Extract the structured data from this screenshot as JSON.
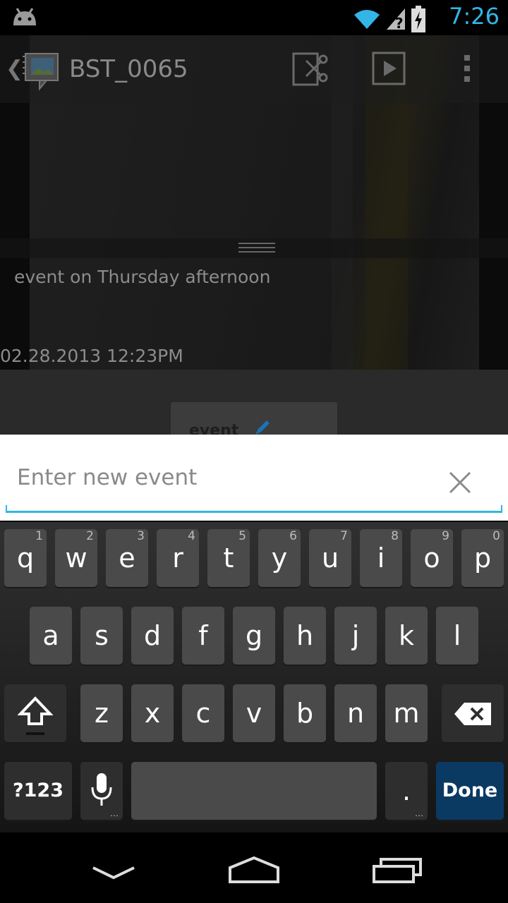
{
  "status_bar": {
    "time": "7:26"
  },
  "action_bar": {
    "title": "BST_0065"
  },
  "info": {
    "description": "event on Thursday afternoon",
    "datetime": "02.28.2013 12:23PM"
  },
  "tag_card": {
    "label": "event"
  },
  "input": {
    "placeholder": "Enter new event",
    "value": ""
  },
  "keyboard": {
    "row1": [
      {
        "ch": "q",
        "num": "1"
      },
      {
        "ch": "w",
        "num": "2"
      },
      {
        "ch": "e",
        "num": "3"
      },
      {
        "ch": "r",
        "num": "4"
      },
      {
        "ch": "t",
        "num": "5"
      },
      {
        "ch": "y",
        "num": "6"
      },
      {
        "ch": "u",
        "num": "7"
      },
      {
        "ch": "i",
        "num": "8"
      },
      {
        "ch": "o",
        "num": "9"
      },
      {
        "ch": "p",
        "num": "0"
      }
    ],
    "row2": [
      "a",
      "s",
      "d",
      "f",
      "g",
      "h",
      "j",
      "k",
      "l"
    ],
    "row3": [
      "z",
      "x",
      "c",
      "v",
      "b",
      "n",
      "m"
    ],
    "symbols_label": "?123",
    "period_label": ".",
    "done_label": "Done"
  },
  "colors": {
    "accent": "#33b5e5",
    "done_key": "#0a3a62"
  }
}
